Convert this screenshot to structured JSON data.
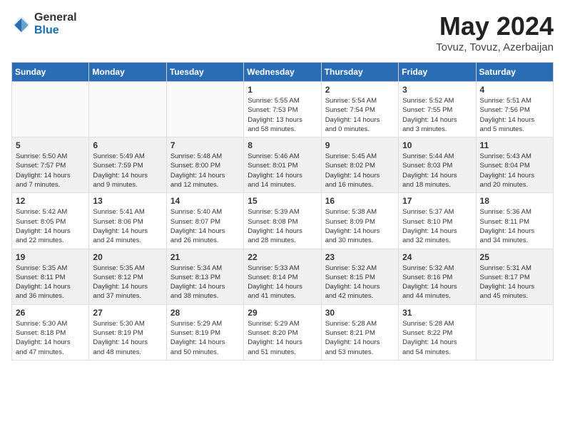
{
  "logo": {
    "general": "General",
    "blue": "Blue"
  },
  "title": "May 2024",
  "location": "Tovuz, Tovuz, Azerbaijan",
  "days_of_week": [
    "Sunday",
    "Monday",
    "Tuesday",
    "Wednesday",
    "Thursday",
    "Friday",
    "Saturday"
  ],
  "weeks": [
    {
      "shaded": false,
      "days": [
        {
          "num": "",
          "info": ""
        },
        {
          "num": "",
          "info": ""
        },
        {
          "num": "",
          "info": ""
        },
        {
          "num": "1",
          "info": "Sunrise: 5:55 AM\nSunset: 7:53 PM\nDaylight: 13 hours\nand 58 minutes."
        },
        {
          "num": "2",
          "info": "Sunrise: 5:54 AM\nSunset: 7:54 PM\nDaylight: 14 hours\nand 0 minutes."
        },
        {
          "num": "3",
          "info": "Sunrise: 5:52 AM\nSunset: 7:55 PM\nDaylight: 14 hours\nand 3 minutes."
        },
        {
          "num": "4",
          "info": "Sunrise: 5:51 AM\nSunset: 7:56 PM\nDaylight: 14 hours\nand 5 minutes."
        }
      ]
    },
    {
      "shaded": true,
      "days": [
        {
          "num": "5",
          "info": "Sunrise: 5:50 AM\nSunset: 7:57 PM\nDaylight: 14 hours\nand 7 minutes."
        },
        {
          "num": "6",
          "info": "Sunrise: 5:49 AM\nSunset: 7:59 PM\nDaylight: 14 hours\nand 9 minutes."
        },
        {
          "num": "7",
          "info": "Sunrise: 5:48 AM\nSunset: 8:00 PM\nDaylight: 14 hours\nand 12 minutes."
        },
        {
          "num": "8",
          "info": "Sunrise: 5:46 AM\nSunset: 8:01 PM\nDaylight: 14 hours\nand 14 minutes."
        },
        {
          "num": "9",
          "info": "Sunrise: 5:45 AM\nSunset: 8:02 PM\nDaylight: 14 hours\nand 16 minutes."
        },
        {
          "num": "10",
          "info": "Sunrise: 5:44 AM\nSunset: 8:03 PM\nDaylight: 14 hours\nand 18 minutes."
        },
        {
          "num": "11",
          "info": "Sunrise: 5:43 AM\nSunset: 8:04 PM\nDaylight: 14 hours\nand 20 minutes."
        }
      ]
    },
    {
      "shaded": false,
      "days": [
        {
          "num": "12",
          "info": "Sunrise: 5:42 AM\nSunset: 8:05 PM\nDaylight: 14 hours\nand 22 minutes."
        },
        {
          "num": "13",
          "info": "Sunrise: 5:41 AM\nSunset: 8:06 PM\nDaylight: 14 hours\nand 24 minutes."
        },
        {
          "num": "14",
          "info": "Sunrise: 5:40 AM\nSunset: 8:07 PM\nDaylight: 14 hours\nand 26 minutes."
        },
        {
          "num": "15",
          "info": "Sunrise: 5:39 AM\nSunset: 8:08 PM\nDaylight: 14 hours\nand 28 minutes."
        },
        {
          "num": "16",
          "info": "Sunrise: 5:38 AM\nSunset: 8:09 PM\nDaylight: 14 hours\nand 30 minutes."
        },
        {
          "num": "17",
          "info": "Sunrise: 5:37 AM\nSunset: 8:10 PM\nDaylight: 14 hours\nand 32 minutes."
        },
        {
          "num": "18",
          "info": "Sunrise: 5:36 AM\nSunset: 8:11 PM\nDaylight: 14 hours\nand 34 minutes."
        }
      ]
    },
    {
      "shaded": true,
      "days": [
        {
          "num": "19",
          "info": "Sunrise: 5:35 AM\nSunset: 8:11 PM\nDaylight: 14 hours\nand 36 minutes."
        },
        {
          "num": "20",
          "info": "Sunrise: 5:35 AM\nSunset: 8:12 PM\nDaylight: 14 hours\nand 37 minutes."
        },
        {
          "num": "21",
          "info": "Sunrise: 5:34 AM\nSunset: 8:13 PM\nDaylight: 14 hours\nand 38 minutes."
        },
        {
          "num": "22",
          "info": "Sunrise: 5:33 AM\nSunset: 8:14 PM\nDaylight: 14 hours\nand 41 minutes."
        },
        {
          "num": "23",
          "info": "Sunrise: 5:32 AM\nSunset: 8:15 PM\nDaylight: 14 hours\nand 42 minutes."
        },
        {
          "num": "24",
          "info": "Sunrise: 5:32 AM\nSunset: 8:16 PM\nDaylight: 14 hours\nand 44 minutes."
        },
        {
          "num": "25",
          "info": "Sunrise: 5:31 AM\nSunset: 8:17 PM\nDaylight: 14 hours\nand 45 minutes."
        }
      ]
    },
    {
      "shaded": false,
      "days": [
        {
          "num": "26",
          "info": "Sunrise: 5:30 AM\nSunset: 8:18 PM\nDaylight: 14 hours\nand 47 minutes."
        },
        {
          "num": "27",
          "info": "Sunrise: 5:30 AM\nSunset: 8:19 PM\nDaylight: 14 hours\nand 48 minutes."
        },
        {
          "num": "28",
          "info": "Sunrise: 5:29 AM\nSunset: 8:19 PM\nDaylight: 14 hours\nand 50 minutes."
        },
        {
          "num": "29",
          "info": "Sunrise: 5:29 AM\nSunset: 8:20 PM\nDaylight: 14 hours\nand 51 minutes."
        },
        {
          "num": "30",
          "info": "Sunrise: 5:28 AM\nSunset: 8:21 PM\nDaylight: 14 hours\nand 53 minutes."
        },
        {
          "num": "31",
          "info": "Sunrise: 5:28 AM\nSunset: 8:22 PM\nDaylight: 14 hours\nand 54 minutes."
        },
        {
          "num": "",
          "info": ""
        }
      ]
    }
  ]
}
